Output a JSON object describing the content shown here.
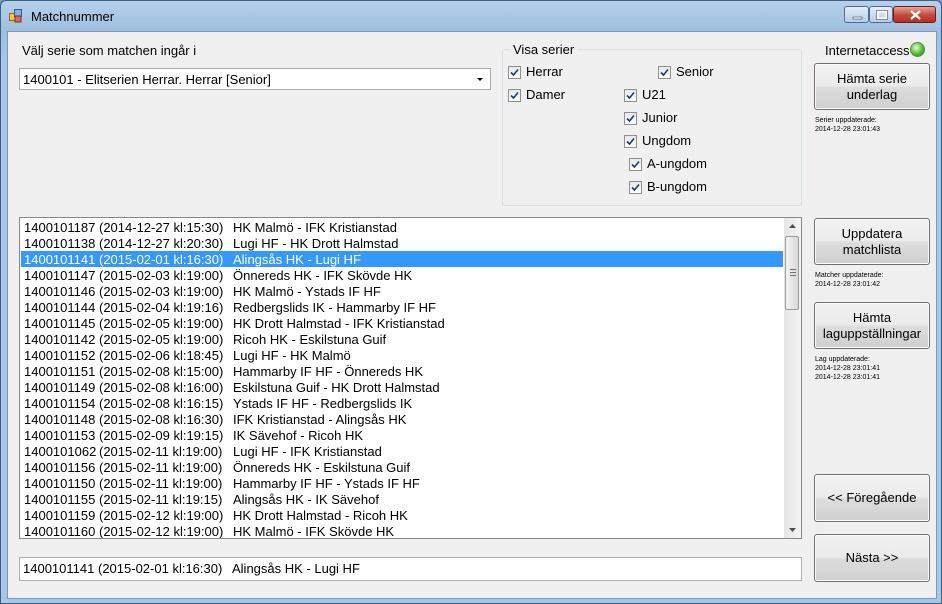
{
  "window": {
    "title": "Matchnummer"
  },
  "serie_select": {
    "label": "Välj serie som matchen ingår i",
    "selected": "1400101 - Elitserien Herrar. Herrar [Senior]"
  },
  "visa_serier": {
    "title": "Visa serier",
    "herrar": {
      "label": "Herrar",
      "checked": true
    },
    "damer": {
      "label": "Damer",
      "checked": true
    },
    "senior": {
      "label": "Senior",
      "checked": true
    },
    "u21": {
      "label": "U21",
      "checked": true
    },
    "junior": {
      "label": "Junior",
      "checked": true
    },
    "ungdom": {
      "label": "Ungdom",
      "checked": true
    },
    "a_ungdom": {
      "label": "A-ungdom",
      "checked": true
    },
    "b_ungdom": {
      "label": "B-ungdom",
      "checked": true
    }
  },
  "internet": {
    "label": "Internetaccess",
    "status_color": "#4cc02f"
  },
  "buttons": {
    "hamta_serie_line1": "Hämta serie",
    "hamta_serie_line2": "underlag",
    "uppdatera_line1": "Uppdatera",
    "uppdatera_line2": "matchlista",
    "hamta_lag_line1": "Hämta",
    "hamta_lag_line2": "laguppställningar",
    "foregaende": "<< Föregående",
    "nasta": "Nästa >>"
  },
  "status_notes": {
    "serier_label": "Serier uppdaterade:",
    "serier_time": "2014-12-28 23:01:43",
    "matcher_label": "Matcher uppdaterade:",
    "matcher_time": "2014-12-28 23:01:42",
    "lag_label": "Lag uppdaterade:",
    "lag_time1": "2014-12-28 23:01:41",
    "lag_time2": "2014-12-28 23:01:41"
  },
  "matches": [
    {
      "id": "1400101187",
      "datetime": "(2014-12-27 kl:15:30)",
      "teams": "HK Malmö - IFK Kristianstad"
    },
    {
      "id": "1400101138",
      "datetime": "(2014-12-27 kl:20:30)",
      "teams": "Lugi HF - HK Drott Halmstad"
    },
    {
      "id": "1400101141",
      "datetime": "(2015-02-01 kl:16:30)",
      "teams": "Alingsås HK - Lugi HF",
      "selected": true
    },
    {
      "id": "1400101147",
      "datetime": "(2015-02-03 kl:19:00)",
      "teams": "Önnereds HK - IFK Skövde HK"
    },
    {
      "id": "1400101146",
      "datetime": "(2015-02-03 kl:19:00)",
      "teams": "HK Malmö - Ystads IF HF"
    },
    {
      "id": "1400101144",
      "datetime": "(2015-02-04 kl:19:16)",
      "teams": "Redbergslids IK - Hammarby IF HF"
    },
    {
      "id": "1400101145",
      "datetime": "(2015-02-05 kl:19:00)",
      "teams": "HK Drott Halmstad - IFK Kristianstad"
    },
    {
      "id": "1400101142",
      "datetime": "(2015-02-05 kl:19:00)",
      "teams": "Ricoh HK - Eskilstuna Guif"
    },
    {
      "id": "1400101152",
      "datetime": "(2015-02-06 kl:18:45)",
      "teams": "Lugi HF - HK Malmö"
    },
    {
      "id": "1400101151",
      "datetime": "(2015-02-08 kl:15:00)",
      "teams": "Hammarby IF HF - Önnereds HK"
    },
    {
      "id": "1400101149",
      "datetime": "(2015-02-08 kl:16:00)",
      "teams": "Eskilstuna Guif - HK Drott Halmstad"
    },
    {
      "id": "1400101154",
      "datetime": "(2015-02-08 kl:16:15)",
      "teams": "Ystads IF HF - Redbergslids IK"
    },
    {
      "id": "1400101148",
      "datetime": "(2015-02-08 kl:16:30)",
      "teams": "IFK Kristianstad - Alingsås HK"
    },
    {
      "id": "1400101153",
      "datetime": "(2015-02-09 kl:19:15)",
      "teams": "IK Sävehof - Ricoh HK"
    },
    {
      "id": "1400101062",
      "datetime": "(2015-02-11 kl:19:00)",
      "teams": "Lugi HF - IFK Kristianstad"
    },
    {
      "id": "1400101156",
      "datetime": "(2015-02-11 kl:19:00)",
      "teams": "Önnereds HK - Eskilstuna Guif"
    },
    {
      "id": "1400101150",
      "datetime": "(2015-02-11 kl:19:00)",
      "teams": "Hammarby IF HF - Ystads IF HF"
    },
    {
      "id": "1400101155",
      "datetime": "(2015-02-11 kl:19:15)",
      "teams": "Alingsås HK - IK Sävehof"
    },
    {
      "id": "1400101159",
      "datetime": "(2015-02-12 kl:19:00)",
      "teams": "HK Drott Halmstad - Ricoh HK"
    },
    {
      "id": "1400101160",
      "datetime": "(2015-02-12 kl:19:00)",
      "teams": "HK Malmö - IFK Skövde HK"
    }
  ],
  "selected_match": {
    "id": "1400101141",
    "datetime": "(2015-02-01 kl:16:30)",
    "teams": "Alingsås HK - Lugi HF"
  }
}
